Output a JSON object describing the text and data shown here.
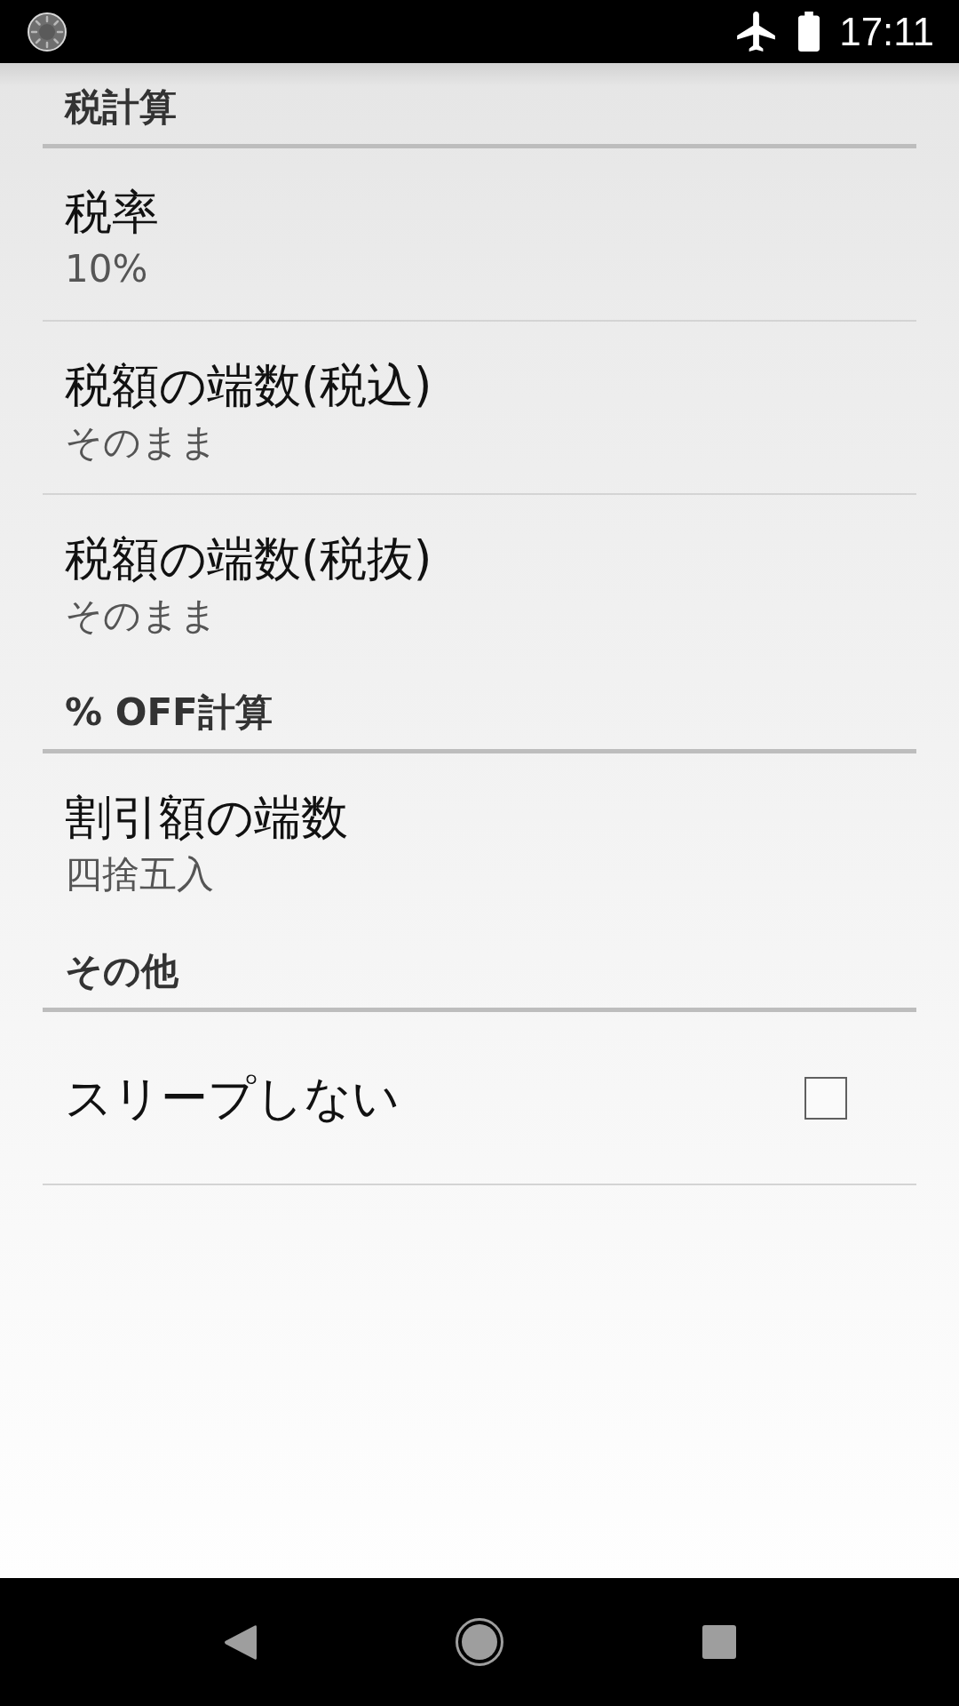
{
  "status_bar": {
    "time": "17:11"
  },
  "sections": [
    {
      "title": "税計算",
      "items": [
        {
          "kind": "value",
          "title": "税率",
          "summary": "10%"
        },
        {
          "kind": "value",
          "title": "税額の端数(税込)",
          "summary": "そのまま"
        },
        {
          "kind": "value",
          "title": "税額の端数(税抜)",
          "summary": "そのまま"
        }
      ]
    },
    {
      "title": "% OFF計算",
      "items": [
        {
          "kind": "value",
          "title": "割引額の端数",
          "summary": "四捨五入"
        }
      ]
    },
    {
      "title": "その他",
      "items": [
        {
          "kind": "checkbox",
          "title": "スリープしない",
          "checked": false
        }
      ]
    }
  ]
}
